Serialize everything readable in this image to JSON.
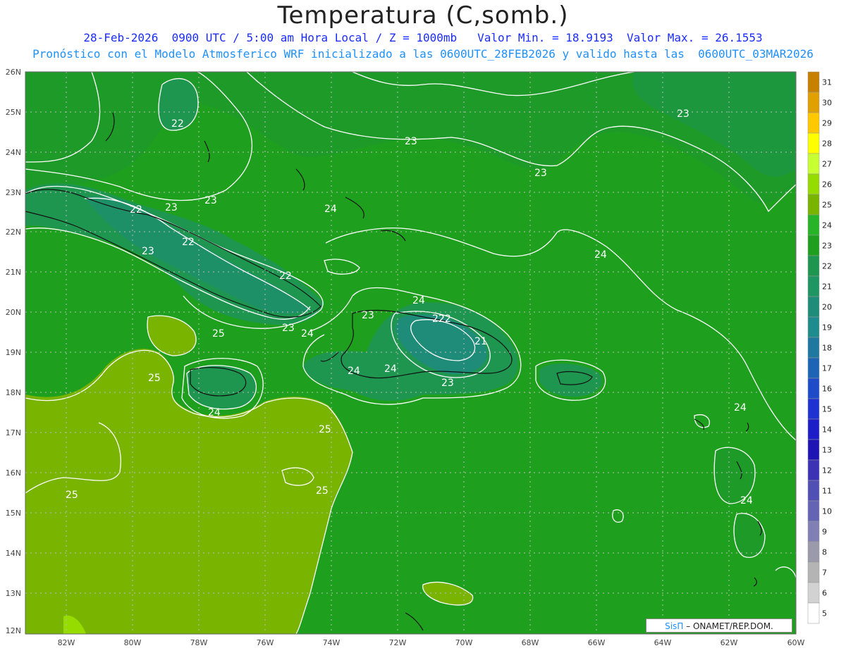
{
  "title": "Temperatura (C,somb.)",
  "subtitle_line1": "28-Feb-2026  0900 UTC / 5:00 am Hora Local / Z = 1000mb   Valor Min. = 18.9193  Valor Max. = 26.1553",
  "subtitle_line2": "Pronóstico con el Modelo Atmosferico WRF inicializado a las 0600UTC_28FEB2026 y valido hasta las  0600UTC_03MAR2026",
  "lat_labels": [
    "26N",
    "25N",
    "24N",
    "23N",
    "22N",
    "21N",
    "20N",
    "19N",
    "18N",
    "17N",
    "16N",
    "15N",
    "14N",
    "13N",
    "12N"
  ],
  "lon_labels": [
    "82W",
    "80W",
    "78W",
    "76W",
    "74W",
    "72W",
    "70W",
    "68W",
    "66W",
    "64W",
    "62W",
    "60W"
  ],
  "colorbar": {
    "levels": [
      "31",
      "30",
      "29",
      "28",
      "27",
      "26",
      "25",
      "24",
      "23",
      "22",
      "21",
      "20",
      "19",
      "18",
      "17",
      "16",
      "15",
      "14",
      "13",
      "12",
      "11",
      "10",
      "9",
      "8",
      "7",
      "6",
      "5"
    ],
    "colors": [
      "#c88000",
      "#e0a000",
      "#ffc800",
      "#ffff00",
      "#c8ff32",
      "#96dc00",
      "#78b400",
      "#28b428",
      "#1ea01e",
      "#1e9650",
      "#1e9664",
      "#1e8c78",
      "#1e8c8c",
      "#1e78a0",
      "#1e64b4",
      "#1e4bc8",
      "#1e32d2",
      "#1e1ec8",
      "#1e14b4",
      "#3c32b4",
      "#5050b4",
      "#6464b4",
      "#8080b4",
      "#9a9aaa",
      "#b4b4b4",
      "#d2d2d2",
      "#ffffff"
    ]
  },
  "contour_labels": [
    "22",
    "23",
    "23",
    "23",
    "23",
    "22",
    "23",
    "22",
    "22",
    "23",
    "24",
    "24",
    "24",
    "25",
    "25",
    "25",
    "25",
    "25",
    "23",
    "24",
    "22",
    "21",
    "24",
    "23",
    "24",
    "24",
    "24",
    "23",
    "22",
    "24"
  ],
  "credit": {
    "brand": "SisΠ",
    "text": " – ONAMET/REP.DOM."
  },
  "chart_data": {
    "type": "heatmap",
    "title": "Temperatura (C,somb.)",
    "variable": "Temperature (C)",
    "level": "1000mb",
    "valid_time": "28-Feb-2026 0900 UTC",
    "min_value": 18.9193,
    "max_value": 26.1553,
    "lat_range": [
      12,
      26
    ],
    "lon_range": [
      -83,
      -60
    ],
    "contour_levels": [
      21,
      22,
      23,
      24,
      25
    ]
  }
}
